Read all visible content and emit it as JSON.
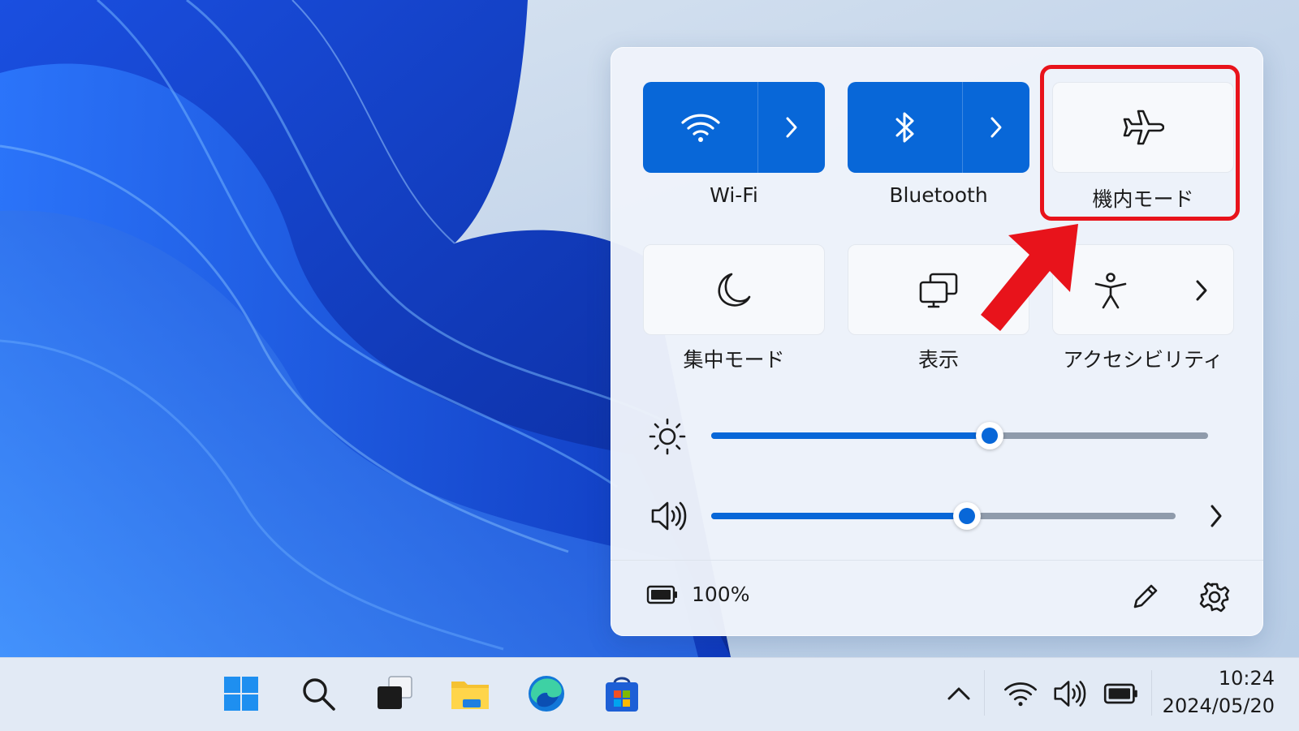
{
  "quick_settings": {
    "tiles": [
      {
        "label": "Wi-Fi",
        "icon": "wifi-icon",
        "state": "on"
      },
      {
        "label": "Bluetooth",
        "icon": "bluetooth-icon",
        "state": "on"
      },
      {
        "label": "機内モード",
        "icon": "airplane-icon",
        "state": "off"
      },
      {
        "label": "集中モード",
        "icon": "moon-icon",
        "state": "off"
      },
      {
        "label": "表示",
        "icon": "display-icon",
        "state": "off"
      },
      {
        "label": "アクセシビリティ",
        "icon": "accessibility-icon",
        "state": "off"
      }
    ],
    "brightness": {
      "icon": "sun-icon",
      "value_percent": 56
    },
    "volume": {
      "icon": "speaker-icon",
      "value_percent": 55
    },
    "battery_text": "100%",
    "footer_icons": [
      "pencil-icon",
      "gear-icon"
    ]
  },
  "annotation": {
    "highlight_color": "#e8131b",
    "target": "機内モード"
  },
  "taskbar": {
    "apps": [
      "windows-start-icon",
      "search-icon",
      "task-view-icon",
      "file-explorer-icon",
      "edge-icon",
      "store-icon"
    ],
    "tray": [
      "chevron-up-icon",
      "wifi-icon",
      "speaker-icon",
      "battery-icon"
    ],
    "time": "10:24",
    "date": "2024/05/20"
  },
  "colors": {
    "accent": "#0867d8"
  }
}
